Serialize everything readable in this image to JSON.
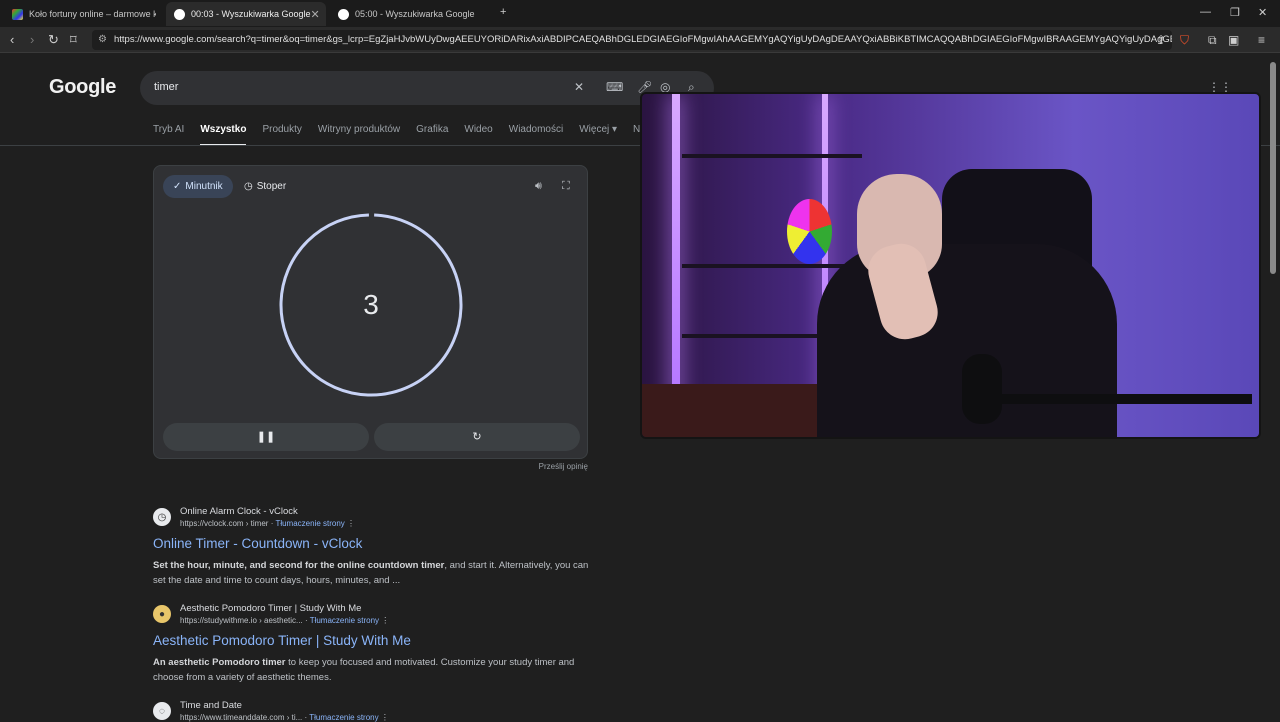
{
  "browser": {
    "tabs": [
      {
        "title": "Koło fortuny online – darmowe koło",
        "active": false
      },
      {
        "title": "00:03 - Wyszukiwarka Google",
        "active": true
      },
      {
        "title": "05:00 - Wyszukiwarka Google",
        "active": false
      }
    ],
    "url": "https://www.google.com/search?q=timer&oq=timer&gs_lcrp=EgZjaHJvbWUyDwgAEEUYORiDARixAxiABDIPCAEQABhDGLEDGIAEGIoFMgwIAhAAGEMYgAQYigUyDAgDEAAYQxiABBiKBTIMCAQQABhDGIAEGIoFMgwIBRAAGEMYgAQYigUyDAgGEAAYQx..."
  },
  "google": {
    "logo": "Google",
    "query": "timer",
    "tabs": [
      "Tryb AI",
      "Wszystko",
      "Produkty",
      "Witryny produktów",
      "Grafika",
      "Wideo",
      "Wiadomości",
      "Więcej",
      "Na"
    ],
    "active_tab": "Wszystko"
  },
  "timer_widget": {
    "mode_active": "Minutnik",
    "mode_other": "Stoper",
    "display": "3",
    "feedback": "Prześlij opinię"
  },
  "results": [
    {
      "site": "Online Alarm Clock - vClock",
      "url": "https://vclock.com › timer",
      "translate": "Tłumaczenie strony",
      "title": "Online Timer - Countdown - vClock",
      "snippet_bold": "Set the hour, minute, and second for the online countdown timer",
      "snippet": ", and start it. Alternatively, you can set the date and time to count days, hours, minutes, and ..."
    },
    {
      "site": "Aesthetic Pomodoro Timer | Study With Me",
      "url": "https://studywithme.io › aesthetic...",
      "translate": "Tłumaczenie strony",
      "title": "Aesthetic Pomodoro Timer | Study With Me",
      "snippet_bold": "An aesthetic Pomodoro timer",
      "snippet": " to keep you focused and motivated. Customize your study timer and choose from a variety of aesthetic themes."
    },
    {
      "site": "Time and Date",
      "url": "https://www.timeanddate.com › ti...",
      "translate": "Tłumaczenie strony"
    }
  ]
}
